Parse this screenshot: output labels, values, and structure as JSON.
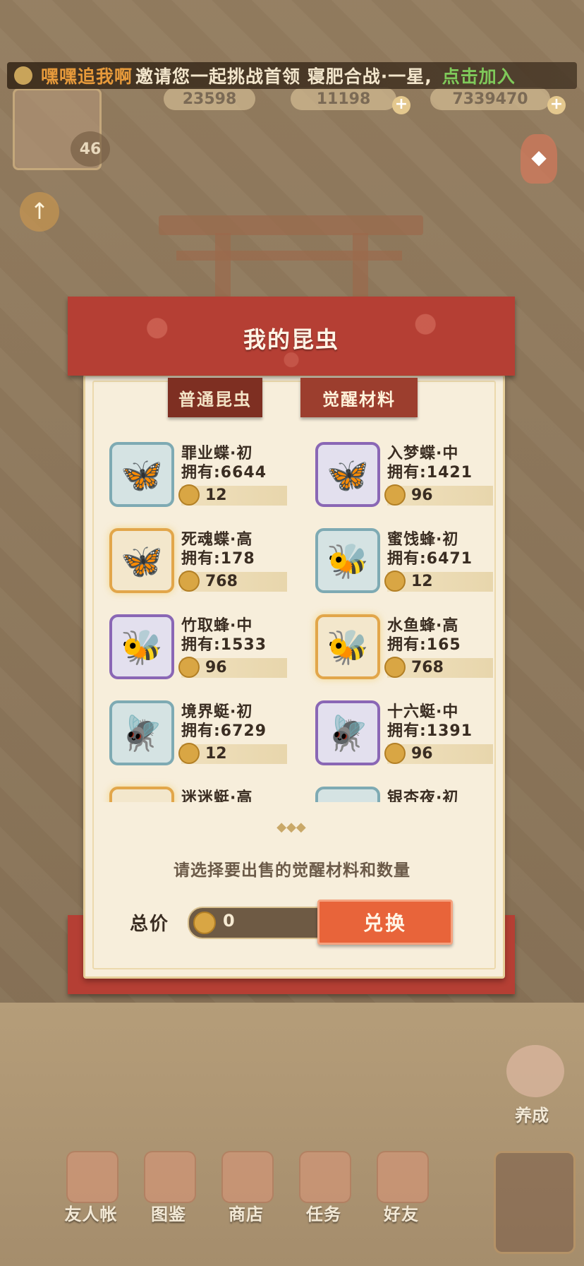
{
  "hud": {
    "marquee_user": "嘿嘿追我啊",
    "marquee_message": "邀请您一起挑战首领 寝肥合战·一星,",
    "marquee_join": "点击加入",
    "resource_1": "23598",
    "resource_2": "11198",
    "resource_3": "7339470",
    "level": "46"
  },
  "dialog": {
    "title": "我的昆虫",
    "tabs": [
      {
        "label": "普通昆虫",
        "active": false
      },
      {
        "label": "觉醒材料",
        "active": true
      }
    ],
    "items": [
      {
        "name": "罪业蝶·初",
        "owned": "拥有:6644",
        "price": "12",
        "frame": "blue",
        "icon": "butterfly-icon",
        "glyph": "🦋"
      },
      {
        "name": "入梦蝶·中",
        "owned": "拥有:1421",
        "price": "96",
        "frame": "purple",
        "icon": "butterfly-icon",
        "glyph": "🦋"
      },
      {
        "name": "死魂蝶·高",
        "owned": "拥有:178",
        "price": "768",
        "frame": "gold",
        "icon": "butterfly-icon",
        "glyph": "🦋"
      },
      {
        "name": "蜜饯蜂·初",
        "owned": "拥有:6471",
        "price": "12",
        "frame": "blue",
        "icon": "bee-icon",
        "glyph": "🐝"
      },
      {
        "name": "竹取蜂·中",
        "owned": "拥有:1533",
        "price": "96",
        "frame": "purple",
        "icon": "bee-icon",
        "glyph": "🐝"
      },
      {
        "name": "水鱼蜂·高",
        "owned": "拥有:165",
        "price": "768",
        "frame": "gold",
        "icon": "bee-icon",
        "glyph": "🐝"
      },
      {
        "name": "境界蜓·初",
        "owned": "拥有:6729",
        "price": "12",
        "frame": "blue",
        "icon": "dragonfly-icon",
        "glyph": "🪰"
      },
      {
        "name": "十六蜓·中",
        "owned": "拥有:1391",
        "price": "96",
        "frame": "purple",
        "icon": "dragonfly-icon",
        "glyph": "🪰"
      },
      {
        "name": "迷迷蜓·高",
        "owned": "",
        "price": "",
        "frame": "gold",
        "icon": "dragonfly-icon",
        "glyph": ""
      },
      {
        "name": "银杏夜·初",
        "owned": "",
        "price": "",
        "frame": "blue",
        "icon": "moth-icon",
        "glyph": ""
      }
    ],
    "hint": "请选择要出售的觉醒材料和数量",
    "total_label": "总价",
    "total_value": "0",
    "exchange_label": "兑换"
  },
  "nav": {
    "items": [
      "友人帐",
      "图鉴",
      "商店",
      "任务",
      "好友"
    ],
    "raise": "养成"
  },
  "colors": {
    "banner_red": "#b53f34",
    "card_bg": "#f7eedb",
    "exchange_orange": "#e8643a",
    "marquee_user": "#e79a3b",
    "marquee_join": "#7fc95a"
  }
}
